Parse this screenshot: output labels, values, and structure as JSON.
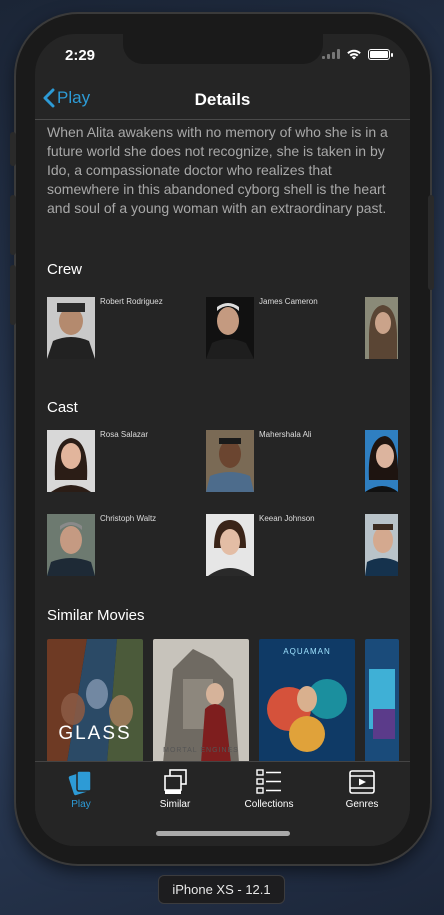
{
  "status_bar": {
    "time": "2:29"
  },
  "navbar": {
    "back_label": "Play",
    "title": "Details"
  },
  "overview": "When Alita awakens with no memory of who she is in a future world she does not recognize, she is taken in by Ido, a compassionate doctor who realizes that somewhere in this abandoned cyborg shell is the heart and soul of a young woman with an extraordinary past.",
  "crew": {
    "title": "Crew",
    "people": [
      {
        "name": "Robert Rodriguez"
      },
      {
        "name": "James Cameron"
      },
      {
        "name": ""
      }
    ]
  },
  "cast": {
    "title": "Cast",
    "rows": [
      [
        {
          "name": "Rosa Salazar"
        },
        {
          "name": "Mahershala Ali"
        },
        {
          "name": ""
        }
      ],
      [
        {
          "name": "Christoph Waltz"
        },
        {
          "name": "Keean Johnson"
        },
        {
          "name": ""
        }
      ]
    ]
  },
  "similar": {
    "title": "Similar Movies",
    "posters": [
      {
        "title": "GLASS"
      },
      {
        "title": "MORTAL ENGINES"
      },
      {
        "title": "AQUAMAN"
      },
      {
        "title": ""
      }
    ]
  },
  "tabs": [
    {
      "label": "Play",
      "icon": "play-cards-icon",
      "active": true
    },
    {
      "label": "Similar",
      "icon": "similar-icon",
      "active": false
    },
    {
      "label": "Collections",
      "icon": "collections-list-icon",
      "active": false
    },
    {
      "label": "Genres",
      "icon": "genres-film-icon",
      "active": false
    }
  ],
  "device_label": "iPhone XS - 12.1",
  "colors": {
    "accent": "#2d9bd6",
    "background": "#252525"
  }
}
